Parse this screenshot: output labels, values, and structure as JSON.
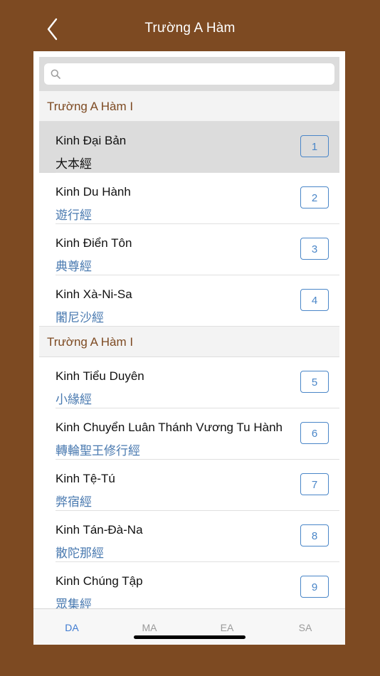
{
  "nav": {
    "title": "Trường A Hàm",
    "back_icon": "chevron-left-icon"
  },
  "search": {
    "placeholder": "",
    "icon": "search-icon"
  },
  "sections": [
    {
      "title": "Trường A Hàm I",
      "items": [
        {
          "title": "Kinh Đại Bản",
          "subtitle": "大本經",
          "number": "1",
          "selected": true
        },
        {
          "title": "Kinh Du Hành",
          "subtitle": "遊行經",
          "number": "2"
        },
        {
          "title": "Kinh Điển Tôn",
          "subtitle": "典尊經",
          "number": "3"
        },
        {
          "title": "Kinh Xà-Ni-Sa",
          "subtitle": "闍尼沙經",
          "number": "4"
        }
      ]
    },
    {
      "title": "Trường A Hàm I",
      "items": [
        {
          "title": "Kinh Tiểu Duyên",
          "subtitle": "小緣經",
          "number": "5"
        },
        {
          "title": "Kinh Chuyển Luân Thánh Vương Tu Hành",
          "subtitle": "轉輪聖王修行經",
          "number": "6"
        },
        {
          "title": "Kinh Tệ-Tú",
          "subtitle": "弊宿經",
          "number": "7"
        },
        {
          "title": "Kinh Tán-Đà-Na",
          "subtitle": "散陀那經",
          "number": "8"
        },
        {
          "title": "Kinh Chúng Tập",
          "subtitle": "眾集經",
          "number": "9"
        }
      ]
    }
  ],
  "tabs": [
    {
      "label": "DA",
      "active": true
    },
    {
      "label": "MA"
    },
    {
      "label": "EA"
    },
    {
      "label": "SA"
    }
  ],
  "colors": {
    "background": "#7d4a22",
    "accent": "#3f7bd1",
    "section_text": "#7d4a22"
  }
}
